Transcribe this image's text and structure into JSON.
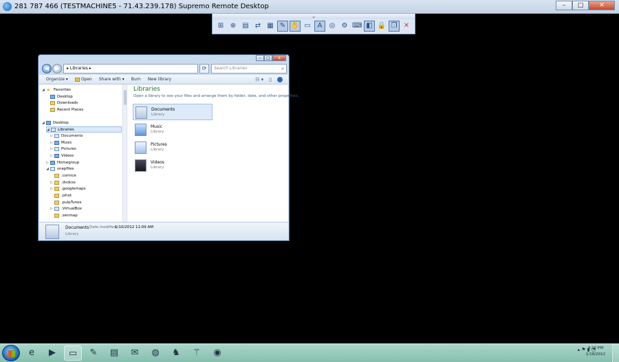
{
  "outer_window": {
    "title": "281 787 466 (TESTMACHINE5 - 71.43.239.178)  Supremo Remote Desktop",
    "buttons": [
      "–",
      "□",
      "✕"
    ]
  },
  "remote_toolbar": {
    "handle": "⌄",
    "icons": [
      {
        "name": "fit-screen-icon",
        "glyph": "⊞"
      },
      {
        "name": "actual-size-icon",
        "glyph": "⊕"
      },
      {
        "name": "clipboard-icon",
        "glyph": "▤"
      },
      {
        "name": "file-transfer-icon",
        "glyph": "⇄"
      },
      {
        "name": "chat-icon",
        "glyph": "▦"
      },
      {
        "name": "draw-icon",
        "glyph": "✎",
        "active": true
      },
      {
        "name": "pointer-icon",
        "glyph": "✋",
        "active": true
      },
      {
        "name": "monitor-icon",
        "glyph": "▭"
      },
      {
        "name": "text-icon",
        "glyph": "A",
        "active": true
      },
      {
        "name": "balloon-icon",
        "glyph": "◎"
      },
      {
        "name": "settings-icon",
        "glyph": "⚙"
      },
      {
        "name": "keyboard-icon",
        "glyph": "⌨"
      },
      {
        "name": "eraser-icon",
        "glyph": "◧",
        "active": true
      },
      {
        "name": "lock-icon",
        "glyph": "🔒"
      },
      {
        "name": "window-icon",
        "glyph": "❐",
        "active": true
      },
      {
        "name": "close-icon",
        "glyph": "✕"
      }
    ]
  },
  "explorer": {
    "window_buttons": [
      "–",
      "□",
      "x"
    ],
    "back": "◀",
    "forward": "▶",
    "address": "▸ Libraries ▸",
    "refresh": "⟳",
    "search_placeholder": "Search Libraries",
    "search_glyph": "⌕",
    "commands": {
      "organize": "Organize ▾",
      "open": "Open",
      "share_with": "Share with ▾",
      "burn": "Burn",
      "new_library": "New library"
    },
    "view_glyph": "☷ ▾",
    "preview_glyph": "▯",
    "help_glyph": "?",
    "nav": {
      "favorites": "Favorites",
      "desktop_fav": "Desktop",
      "downloads": "Downloads",
      "recent_places": "Recent Places",
      "desktop": "Desktop",
      "libraries": "Libraries",
      "documents": "Documents",
      "music": "Music",
      "pictures": "Pictures",
      "videos": "Videos",
      "homegroup": "Homegroup",
      "snapfiles": "snapfiles",
      "cornice": ".cornice",
      "dvdcss": ".dvdcss",
      "googlemaps": ".googlemaps",
      "jshot": ".jshot",
      "pulptunes": ".pulpTunes",
      "virtualbox": ".VirtualBox",
      "zenmap": ".zenmap"
    },
    "content": {
      "title": "Libraries",
      "description": "Open a library to see your files and arrange them by folder, date, and other properties.",
      "items": [
        {
          "name": "Documents",
          "sub": "Library"
        },
        {
          "name": "Music",
          "sub": "Library"
        },
        {
          "name": "Pictures",
          "sub": "Library"
        },
        {
          "name": "Videos",
          "sub": "Library"
        }
      ]
    },
    "details": {
      "name": "Documents",
      "modified_label": "Date modified:",
      "modified": "1/10/2012 11:09 AM",
      "sub": "Library"
    }
  },
  "taskbar": {
    "icons": [
      {
        "name": "ie-icon",
        "glyph": "e"
      },
      {
        "name": "media-player-icon",
        "glyph": "▶"
      },
      {
        "name": "explorer-folder-icon",
        "glyph": "▭",
        "pinned": true
      },
      {
        "name": "notes-icon",
        "glyph": "✎"
      },
      {
        "name": "network-icon",
        "glyph": "▤"
      },
      {
        "name": "mail-icon",
        "glyph": "✉"
      },
      {
        "name": "globe-icon",
        "glyph": "◍"
      },
      {
        "name": "app-icon",
        "glyph": "♞"
      },
      {
        "name": "ftp-icon",
        "glyph": "⚚"
      },
      {
        "name": "browser-icon",
        "glyph": "◉"
      }
    ],
    "tray_icons": "▴ ⚑ ▮ ◔",
    "clock_time": "3:10 PM",
    "clock_date": "1/18/2012"
  }
}
